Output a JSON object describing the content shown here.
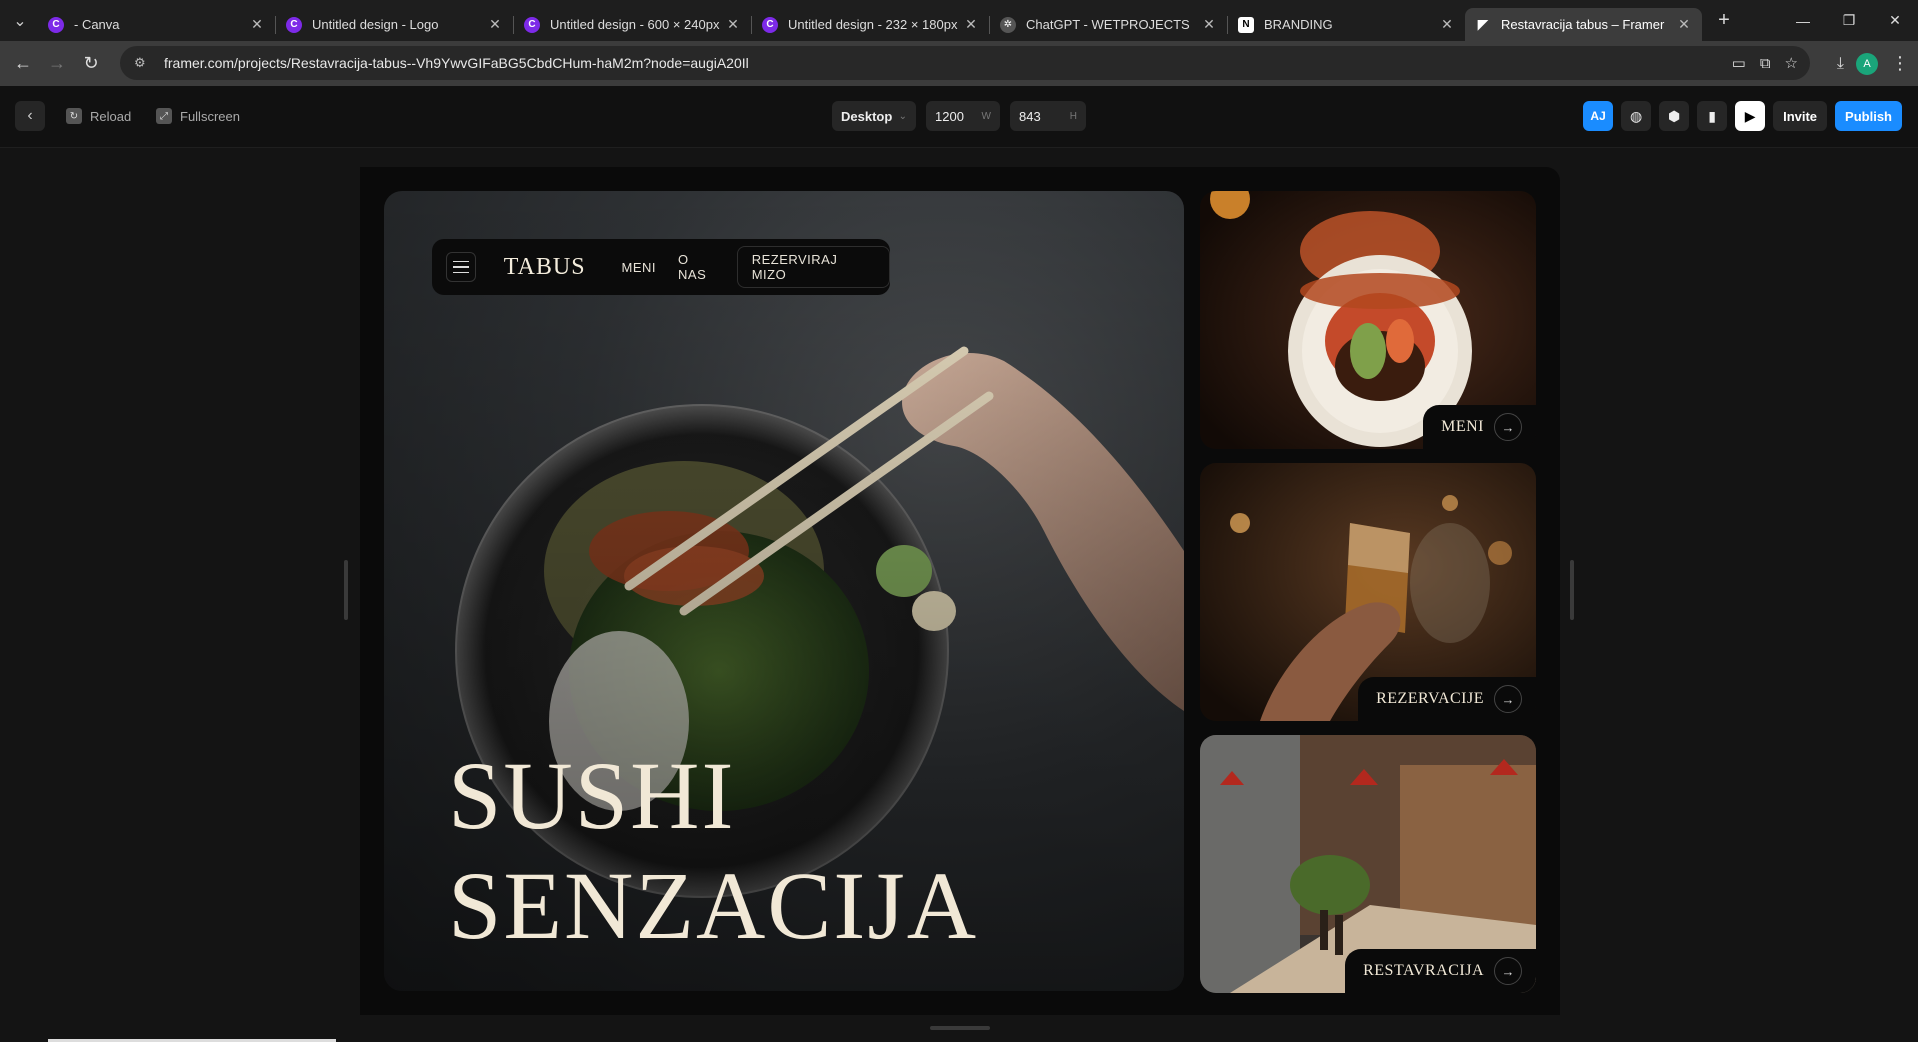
{
  "browser": {
    "tabs": [
      {
        "title": "- Canva",
        "favicon": "canva-icon"
      },
      {
        "title": "Untitled design - Logo",
        "favicon": "canva-icon"
      },
      {
        "title": "Untitled design - 600 × 240px",
        "favicon": "canva-icon"
      },
      {
        "title": "Untitled design - 232 × 180px",
        "favicon": "canva-icon"
      },
      {
        "title": "ChatGPT - WETPROJECTS",
        "favicon": "chatgpt-icon"
      },
      {
        "title": "BRANDING",
        "favicon": "notion-icon"
      },
      {
        "title": "Restavracija tabus – Framer",
        "favicon": "framer-icon",
        "active": true
      }
    ],
    "url": "framer.com/projects/Restavracija-tabus--Vh9YwvGIFaBG5CbdCHum-haM2m?node=augiA20Il",
    "profile_initial": "A"
  },
  "toolbar": {
    "reload_label": "Reload",
    "fullscreen_label": "Fullscreen",
    "device": "Desktop",
    "width_value": "1200",
    "width_suffix": "W",
    "height_value": "843",
    "height_suffix": "H",
    "avatar_initials": "AJ",
    "invite_label": "Invite",
    "publish_label": "Publish",
    "accent_color": "#1a8cff"
  },
  "site": {
    "logo": "TABUS",
    "nav": {
      "menu": "MENI",
      "about": "O NAS",
      "cta": "REZERVIRAJ MIZO"
    },
    "hero_title_line1": "SUSHI",
    "hero_title_line2": "SENZACIJA",
    "cards": [
      {
        "label": "MENI"
      },
      {
        "label": "REZERVACIJE"
      },
      {
        "label": "RESTAVRACIJA"
      }
    ],
    "text_color": "#f1e8d6"
  }
}
